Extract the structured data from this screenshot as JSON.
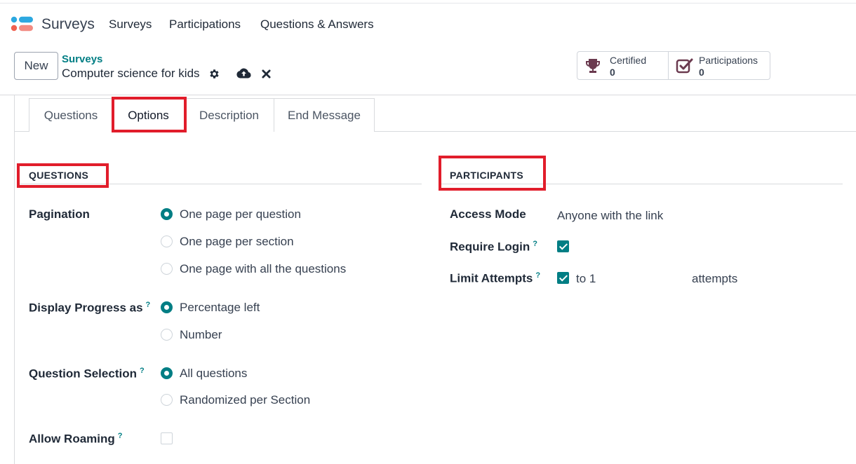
{
  "app": {
    "name": "Surveys",
    "logo_colors": [
      "#00a09d",
      "#2ca8e0",
      "#f06050",
      "#f28b82"
    ]
  },
  "nav": {
    "items": [
      "Surveys",
      "Participations",
      "Questions & Answers"
    ]
  },
  "control_panel": {
    "new_label": "New",
    "breadcrumb_parent": "Surveys",
    "breadcrumb_current": "Computer science for kids",
    "icons": [
      "gear-icon",
      "cloud-upload-icon",
      "close-icon"
    ]
  },
  "stats": [
    {
      "label": "Certified",
      "value": "0",
      "icon": "trophy-icon"
    },
    {
      "label": "Participations",
      "value": "0",
      "icon": "checklist-icon"
    }
  ],
  "tabs": [
    {
      "label": "Questions",
      "active": false
    },
    {
      "label": "Options",
      "active": true
    },
    {
      "label": "Description",
      "active": false
    },
    {
      "label": "End Message",
      "active": false
    }
  ],
  "questions_section": {
    "title": "QUESTIONS",
    "pagination": {
      "label": "Pagination",
      "options": [
        "One page per question",
        "One page per section",
        "One page with all the questions"
      ],
      "selected": "One page per question"
    },
    "progress": {
      "label": "Display Progress as",
      "help": "?",
      "options": [
        "Percentage left",
        "Number"
      ],
      "selected": "Percentage left"
    },
    "selection": {
      "label": "Question Selection",
      "help": "?",
      "options": [
        "All questions",
        "Randomized per Section"
      ],
      "selected": "All questions"
    },
    "roaming": {
      "label": "Allow Roaming",
      "help": "?",
      "checked": false
    }
  },
  "participants_section": {
    "title": "PARTICIPANTS",
    "access_mode": {
      "label": "Access Mode",
      "value": "Anyone with the link"
    },
    "require_login": {
      "label": "Require Login",
      "help": "?",
      "checked": true
    },
    "limit_attempts": {
      "label": "Limit Attempts",
      "help": "?",
      "checked": true,
      "to_text": "to 1",
      "suffix": "attempts"
    }
  },
  "colors": {
    "accent": "#017e84",
    "highlight": "#e11d2b",
    "text": "#374151"
  }
}
